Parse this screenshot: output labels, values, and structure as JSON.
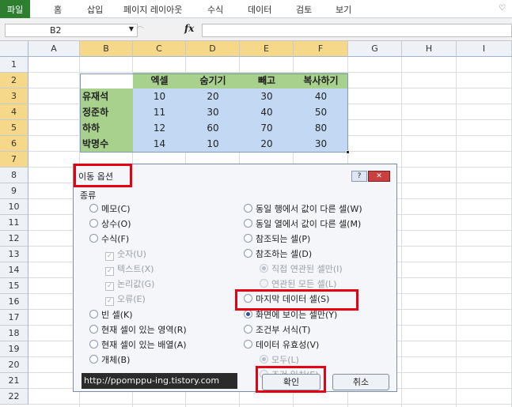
{
  "ribbon": {
    "tabs": [
      "파일",
      "홈",
      "삽입",
      "페이지 레이아웃",
      "수식",
      "데이터",
      "검토",
      "보기"
    ],
    "toggle_icon": "chevron-down-icon"
  },
  "formula_bar": {
    "name_box": "B2",
    "fx_label": "fx",
    "formula": ""
  },
  "grid": {
    "columns": [
      "A",
      "B",
      "C",
      "D",
      "E",
      "F",
      "G",
      "H",
      "I"
    ],
    "selected_columns": [
      "B",
      "C",
      "D",
      "E",
      "F"
    ],
    "rows": [
      "1",
      "2",
      "3",
      "4",
      "5",
      "6",
      "7",
      "8",
      "9",
      "10",
      "11",
      "12",
      "13",
      "14",
      "15",
      "16",
      "17",
      "18",
      "19",
      "20",
      "21",
      "22"
    ],
    "selected_rows": [
      "2",
      "3",
      "4",
      "5",
      "6",
      "7"
    ]
  },
  "table": {
    "headers": [
      "엑셀",
      "숨기기",
      "빼고",
      "복사하기"
    ],
    "rows": [
      {
        "name": "유재석",
        "values": [
          10,
          20,
          30,
          40
        ]
      },
      {
        "name": "정준하",
        "values": [
          11,
          30,
          40,
          50
        ]
      },
      {
        "name": "하하",
        "values": [
          12,
          60,
          70,
          80
        ]
      },
      {
        "name": "박명수",
        "values": [
          14,
          10,
          20,
          30
        ]
      }
    ],
    "colors": {
      "header": "#a8d18d",
      "name_col": "#a8d18d",
      "selection": "#c3d9f3"
    }
  },
  "dialog": {
    "title": "이동 옵션",
    "help_label": "?",
    "close_label": "✕",
    "section_label": "종류",
    "left_options": [
      {
        "label": "메모(C)",
        "checked": false,
        "disabled": false,
        "type": "radio"
      },
      {
        "label": "상수(O)",
        "checked": false,
        "disabled": false,
        "type": "radio"
      },
      {
        "label": "수식(F)",
        "checked": false,
        "disabled": false,
        "type": "radio"
      },
      {
        "label": "숫자(U)",
        "checked": true,
        "disabled": true,
        "type": "checkbox"
      },
      {
        "label": "텍스트(X)",
        "checked": true,
        "disabled": true,
        "type": "checkbox"
      },
      {
        "label": "논리값(G)",
        "checked": true,
        "disabled": true,
        "type": "checkbox"
      },
      {
        "label": "오류(E)",
        "checked": true,
        "disabled": true,
        "type": "checkbox"
      },
      {
        "label": "빈 셀(K)",
        "checked": false,
        "disabled": false,
        "type": "radio"
      },
      {
        "label": "현재 셀이 있는 영역(R)",
        "checked": false,
        "disabled": false,
        "type": "radio"
      },
      {
        "label": "현재 셀이 있는 배열(A)",
        "checked": false,
        "disabled": false,
        "type": "radio"
      },
      {
        "label": "개체(B)",
        "checked": false,
        "disabled": false,
        "type": "radio"
      }
    ],
    "right_options": [
      {
        "label": "동일 행에서 값이 다른 셀(W)",
        "checked": false,
        "disabled": false
      },
      {
        "label": "동일 열에서 값이 다른 셀(M)",
        "checked": false,
        "disabled": false
      },
      {
        "label": "참조되는 셀(P)",
        "checked": false,
        "disabled": false
      },
      {
        "label": "참조하는 셀(D)",
        "checked": false,
        "disabled": false
      },
      {
        "label": "직접 연관된 셀만(I)",
        "checked": true,
        "disabled": true
      },
      {
        "label": "연관된 모든 셀(L)",
        "checked": false,
        "disabled": true
      },
      {
        "label": "마지막 데이터 셀(S)",
        "checked": false,
        "disabled": false
      },
      {
        "label": "화면에 보이는 셀만(Y)",
        "checked": true,
        "disabled": false
      },
      {
        "label": "조건부 서식(T)",
        "checked": false,
        "disabled": false
      },
      {
        "label": "데이터 유효성(V)",
        "checked": false,
        "disabled": false
      },
      {
        "label": "모두(L)",
        "checked": true,
        "disabled": true
      },
      {
        "label": "조건 일치(E)",
        "checked": false,
        "disabled": true
      }
    ],
    "url_text": "http://ppomppu-ing.tistory.com",
    "ok_label": "확인",
    "cancel_label": "취소"
  },
  "highlight_color": "#e60012"
}
